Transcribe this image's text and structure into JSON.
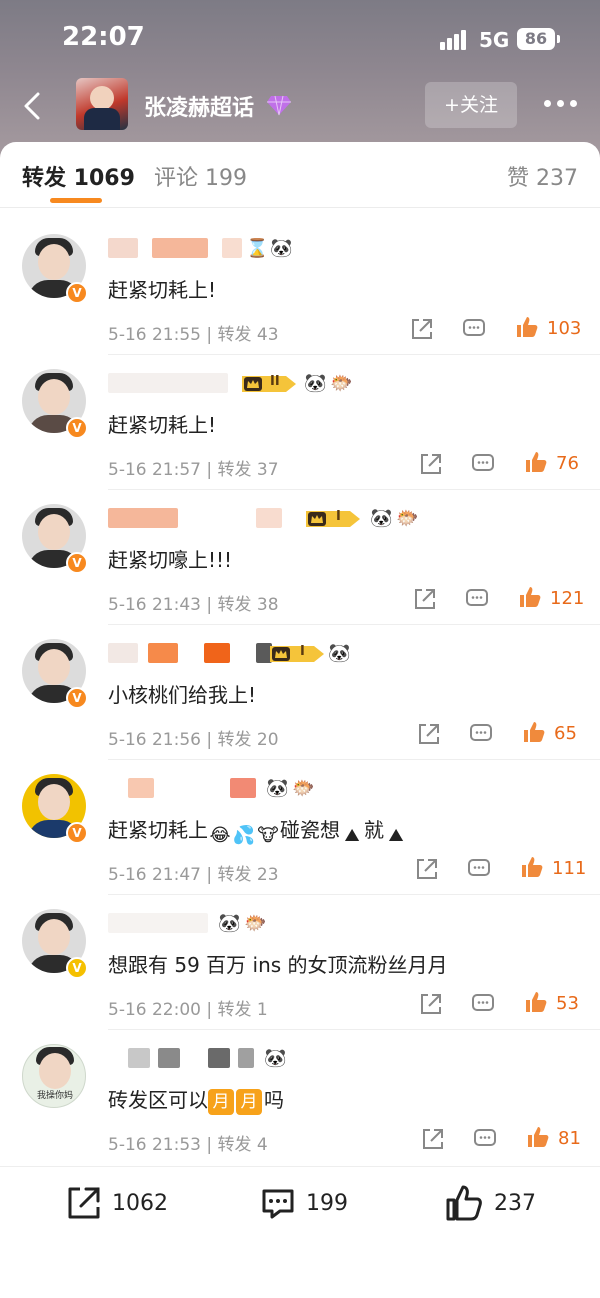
{
  "status": {
    "time": "22:07",
    "network": "5G",
    "battery": "86"
  },
  "header": {
    "group_name": "张凌赫超话",
    "follow_label": "+关注"
  },
  "tabs": [
    {
      "label": "转发 1069"
    },
    {
      "label": "评论 199"
    },
    {
      "label": "赞 237"
    }
  ],
  "comments": [
    {
      "text": "赶紧切耗上!",
      "meta": "5-16 21:55 | 转发 43",
      "likes": "103"
    },
    {
      "text": "赶紧切耗上!",
      "meta": "5-16 21:57 | 转发 37",
      "likes": "76"
    },
    {
      "text": "赶紧切嚎上!!!",
      "meta": "5-16 21:43 | 转发 38",
      "likes": "121"
    },
    {
      "text": "小核桃们给我上!",
      "meta": "5-16 21:56 | 转发 20",
      "likes": "65"
    },
    {
      "text_a": "赶紧切耗上",
      "text_b": "碰瓷想",
      "text_c": "就",
      "meta": "5-16 21:47 | 转发 23",
      "likes": "111"
    },
    {
      "text": "想跟有 59 百万 ins 的女顶流粉丝月月",
      "meta": "5-16 22:00 | 转发 1",
      "likes": "53"
    },
    {
      "text_a": "砖发区可以",
      "tag": "月",
      "text_c": "吗",
      "meta": "5-16 21:53 | 转发 4",
      "likes": "81",
      "avatar_caption": "我操你妈"
    }
  ],
  "level_badges": {
    "ii": "II",
    "i": "I"
  },
  "bottom_bar": {
    "share_count": "1062",
    "comment_count": "199",
    "like_count": "237"
  },
  "colors": {
    "accent": "#f7891f",
    "like": "#e86a1a",
    "meta": "#999999"
  }
}
